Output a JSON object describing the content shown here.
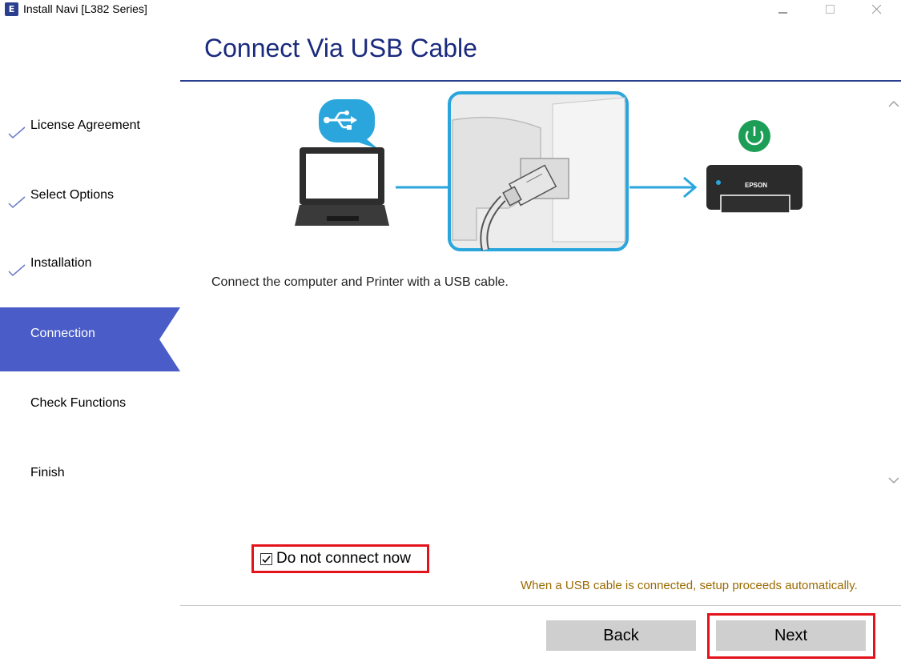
{
  "window": {
    "title": "Install Navi [L382 Series]",
    "app_icon_letter": "E",
    "controls": [
      "minimize-icon",
      "maximize-icon",
      "close-icon"
    ]
  },
  "sidebar": {
    "steps": [
      {
        "label": "License Agreement",
        "status": "done"
      },
      {
        "label": "Select Options",
        "status": "done"
      },
      {
        "label": "Installation",
        "status": "done"
      },
      {
        "label": "Connection",
        "status": "current"
      },
      {
        "label": "Check Functions",
        "status": "pending"
      },
      {
        "label": "Finish",
        "status": "pending"
      }
    ]
  },
  "main": {
    "title": "Connect Via USB Cable",
    "illustration": {
      "printer_brand": "EPSON",
      "icons": [
        "laptop-icon",
        "usb-icon",
        "power-icon",
        "printer-icon"
      ]
    },
    "instruction": "Connect the computer and Printer with a USB cable.",
    "do_not_connect_label": "Do not connect now",
    "do_not_connect_checked": true,
    "hint": "When a USB cable is connected, setup proceeds automatically."
  },
  "footer": {
    "back_label": "Back",
    "next_label": "Next"
  },
  "colors": {
    "accent": "#4a5cc7",
    "title": "#1a2a7d",
    "highlight": "#e3121b",
    "usb_blue": "#2aa6dc",
    "hint": "#9a6a00"
  }
}
